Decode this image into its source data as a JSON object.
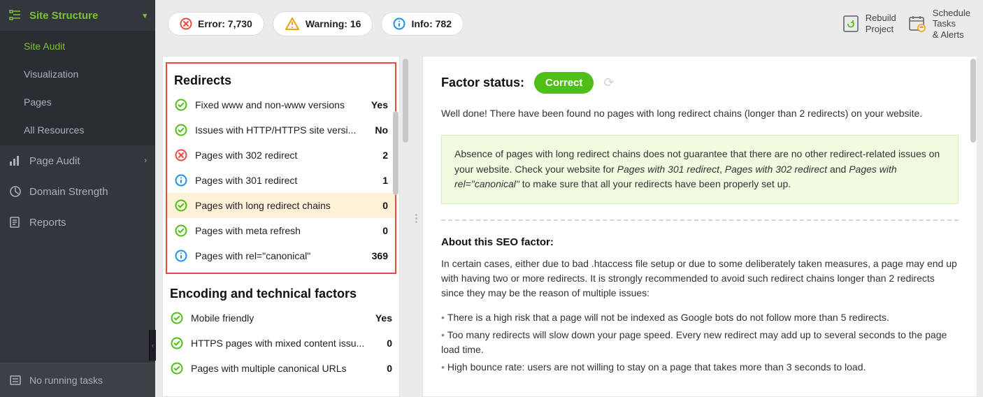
{
  "sidebar": {
    "site_structure": "Site Structure",
    "items": [
      "Site Audit",
      "Visualization",
      "Pages",
      "All Resources"
    ],
    "page_audit": "Page Audit",
    "domain_strength": "Domain Strength",
    "reports": "Reports",
    "footer": "No running tasks"
  },
  "topbar": {
    "error_label": "Error: 7,730",
    "warning_label": "Warning: 16",
    "info_label": "Info: 782",
    "rebuild_line1": "Rebuild",
    "rebuild_line2": "Project",
    "schedule_line1": "Schedule",
    "schedule_line2": "Tasks",
    "schedule_line3": "& Alerts"
  },
  "left": {
    "redirects_head": "Redirects",
    "rows": [
      {
        "label": "Fixed www and non-www versions",
        "value": "Yes",
        "icon": "ok"
      },
      {
        "label": "Issues with HTTP/HTTPS site versi...",
        "value": "No",
        "icon": "ok"
      },
      {
        "label": "Pages with 302 redirect",
        "value": "2",
        "icon": "err"
      },
      {
        "label": "Pages with 301 redirect",
        "value": "1",
        "icon": "info"
      },
      {
        "label": "Pages with long redirect chains",
        "value": "0",
        "icon": "ok",
        "selected": true
      },
      {
        "label": "Pages with meta refresh",
        "value": "0",
        "icon": "ok"
      },
      {
        "label": "Pages with rel=\"canonical\"",
        "value": "369",
        "icon": "info"
      }
    ],
    "enc_head": "Encoding and technical factors",
    "enc_rows": [
      {
        "label": "Mobile friendly",
        "value": "Yes",
        "icon": "ok"
      },
      {
        "label": "HTTPS pages with mixed content issu...",
        "value": "0",
        "icon": "ok"
      },
      {
        "label": "Pages with multiple canonical URLs",
        "value": "0",
        "icon": "ok"
      }
    ]
  },
  "right": {
    "status_label": "Factor status:",
    "badge": "Correct",
    "well_done": "Well done! There have been found no pages with long redirect chains (longer than 2 redirects) on your website.",
    "note_a": "Absence of pages with long redirect chains does not guarantee that there are no other redirect-related issues on your website. Check your website for ",
    "note_i1": "Pages with 301 redirect",
    "note_b": ", ",
    "note_i2": "Pages with 302 redirect",
    "note_c": " and ",
    "note_i3": "Pages with rel=\"canonical\"",
    "note_d": "  to make sure that all your redirects have been properly set up.",
    "about_h": "About this SEO factor:",
    "about_p": "In certain cases, either due to bad .htaccess file setup or due to some deliberately taken measures, a page may end up with having two or more redirects. It is strongly recommended to avoid such redirect chains longer than 2 redirects since they may be the reason of multiple issues:",
    "b1": "There is a high risk that a page will not be indexed as Google bots do not follow more than 5 redirects.",
    "b2": "Too many redirects will slow down your page speed. Every new redirect may add up to several seconds to the page load time.",
    "b3": "High bounce rate: users are not willing to stay on a page that takes more than 3 seconds to load."
  }
}
